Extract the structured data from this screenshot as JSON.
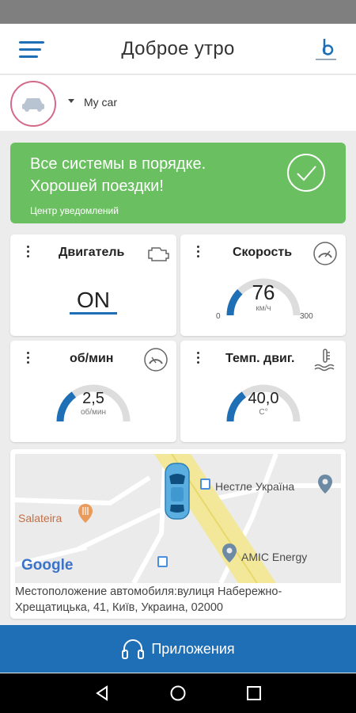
{
  "header": {
    "title": "Доброе утро"
  },
  "car_selector": {
    "name": "My car"
  },
  "notification": {
    "line1": "Все системы в порядке.",
    "line2": "Хорошей поездки!",
    "link": "Центр уведомлений"
  },
  "cards": {
    "engine": {
      "title": "Двигатель",
      "value": "ON"
    },
    "speed": {
      "title": "Скорость",
      "value": "76",
      "unit": "км/ч",
      "min": "0",
      "max": "300",
      "fraction": 0.25
    },
    "rpm": {
      "title": "об/мин",
      "value": "2,5",
      "unit": "об/мин",
      "fraction": 0.3
    },
    "temp": {
      "title": "Темп. двиг.",
      "value": "40,0",
      "unit": "C°",
      "fraction": 0.3
    }
  },
  "map": {
    "poi": [
      "Нестле Україна",
      "Salateira",
      "AMIC Energy"
    ],
    "provider": "Google",
    "address": "Местоположение автомобиля:вулиця Набережно-Хрещатицька, 41, Київ, Украина, 02000"
  },
  "bottom_bar": {
    "label": "Приложения"
  },
  "colors": {
    "primary": "#1e6fb5",
    "success": "#6abf60",
    "gauge_track": "#dddddd"
  }
}
